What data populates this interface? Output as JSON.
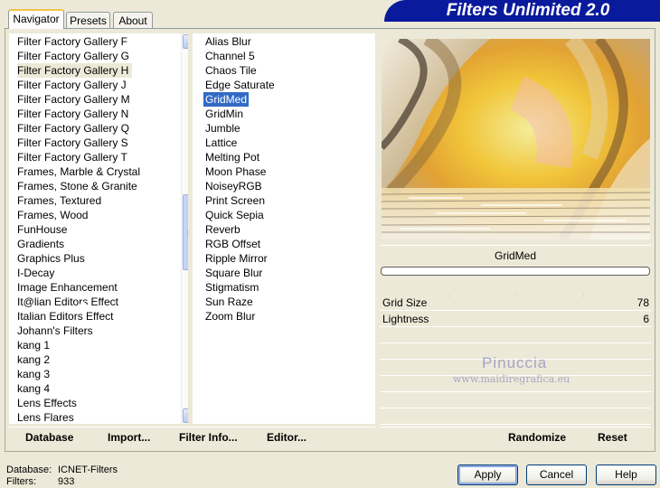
{
  "tabs": [
    {
      "label": "Navigator",
      "active": true
    },
    {
      "label": "Presets",
      "active": false
    },
    {
      "label": "About",
      "active": false
    }
  ],
  "app_title": "Filters Unlimited 2.0",
  "categories": [
    "Filter Factory Gallery F",
    "Filter Factory Gallery G",
    "Filter Factory Gallery H",
    "Filter Factory Gallery J",
    "Filter Factory Gallery M",
    "Filter Factory Gallery N",
    "Filter Factory Gallery Q",
    "Filter Factory Gallery S",
    "Filter Factory Gallery T",
    "Frames, Marble & Crystal",
    "Frames, Stone & Granite",
    "Frames, Textured",
    "Frames, Wood",
    "FunHouse",
    "Gradients",
    "Graphics Plus",
    "I-Decay",
    "Image Enhancement",
    "It@lian Editors Effect",
    "Italian Editors Effect",
    "Johann's Filters",
    "kang 1",
    "kang 2",
    "kang 3",
    "kang 4",
    "Lens Effects",
    "Lens Flares"
  ],
  "selected_category": "Filter Factory Gallery H",
  "filters": [
    "Alias Blur",
    "Channel 5",
    "Chaos Tile",
    "Edge Saturate",
    "GridMed",
    "GridMin",
    "Jumble",
    "Lattice",
    "Melting Pot",
    "Moon Phase",
    "NoiseyRGB",
    "Print Screen",
    "Quick Sepia",
    "Reverb",
    "RGB Offset",
    "Ripple Mirror",
    "Square Blur",
    "Stigmatism",
    "Sun Raze",
    "Zoom Blur"
  ],
  "selected_filter": "GridMed",
  "preview": {
    "filter_name": "GridMed"
  },
  "parameters": [
    {
      "label": "Grid Size",
      "value": "78"
    },
    {
      "label": "Lightness",
      "value": "6"
    }
  ],
  "watermark": {
    "line1": "Pinuccia",
    "line2": "www.maidiregrafica.eu"
  },
  "left_buttons": {
    "database": "Database",
    "import": "Import...",
    "filter_info": "Filter Info...",
    "editor": "Editor..."
  },
  "right_buttons": {
    "randomize": "Randomize",
    "reset": "Reset"
  },
  "status": {
    "database_label": "Database:",
    "database_value": "ICNET-Filters",
    "filters_label": "Filters:",
    "filters_value": "933"
  },
  "dialog_buttons": {
    "apply": "Apply",
    "cancel": "Cancel",
    "help": "Help"
  },
  "colors": {
    "selection_blue": "#316ac5",
    "banner_blue": "#0a1a9c",
    "face": "#ece9d8"
  }
}
